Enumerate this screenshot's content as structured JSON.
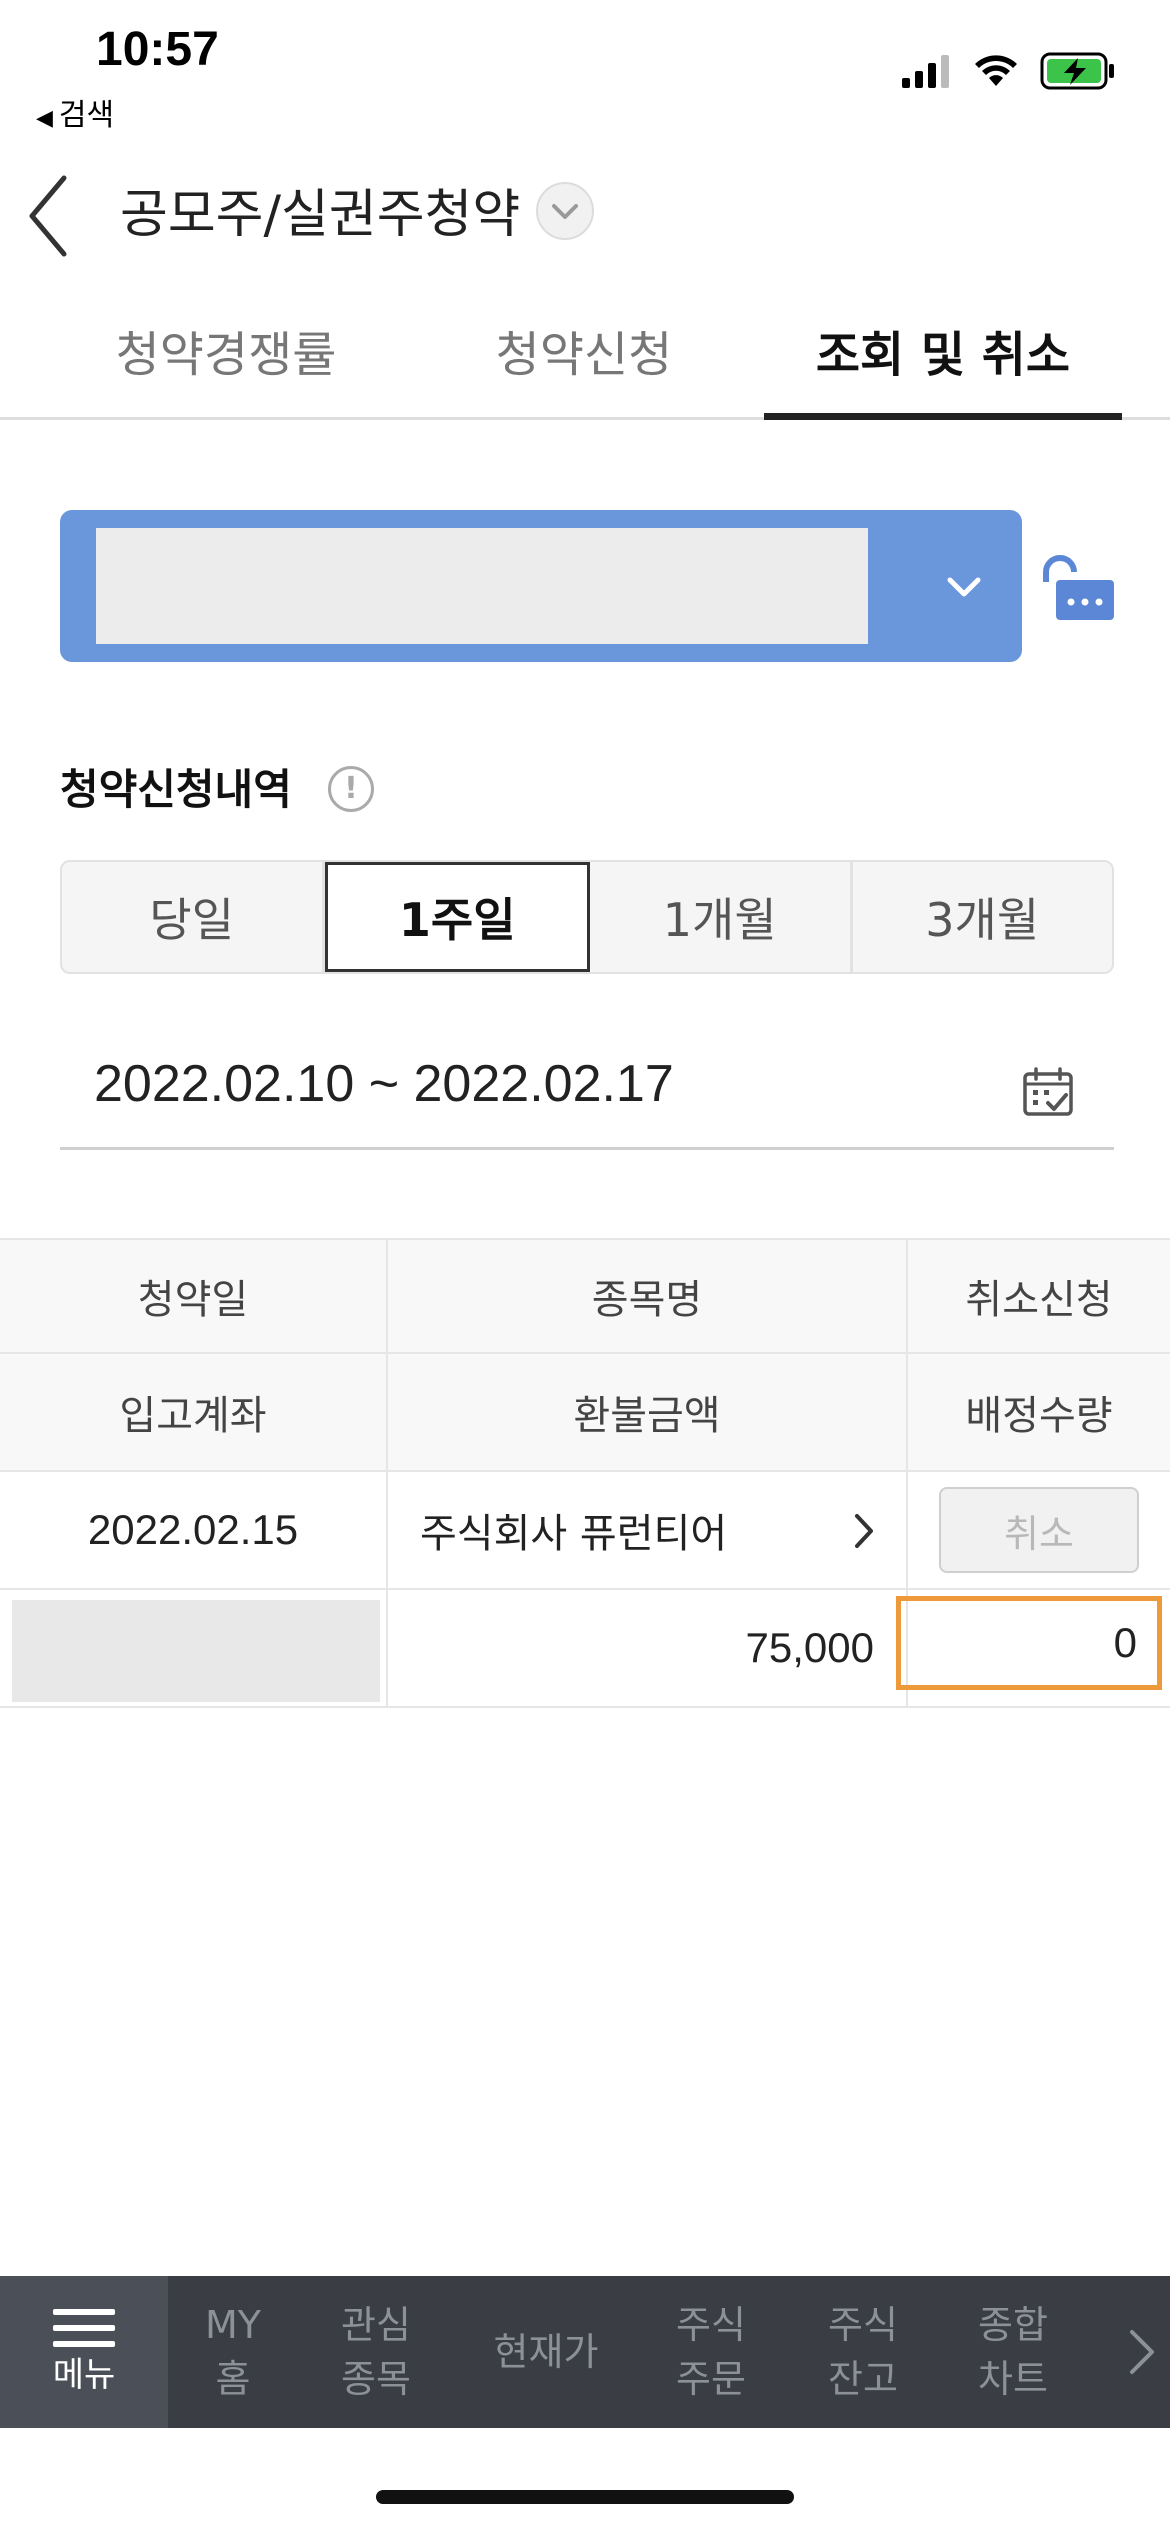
{
  "status": {
    "time": "10:57",
    "back_label": "검색"
  },
  "header": {
    "title": "공모주/실권주청약"
  },
  "tabs": [
    {
      "label": "청약경쟁률",
      "active": false
    },
    {
      "label": "청약신청",
      "active": false
    },
    {
      "label": "조회 및 취소",
      "active": true
    }
  ],
  "section": {
    "title": "청약신청내역",
    "info_symbol": "!"
  },
  "periods": [
    {
      "label": "당일",
      "active": false
    },
    {
      "label": "1주일",
      "active": true
    },
    {
      "label": "1개월",
      "active": false
    },
    {
      "label": "3개월",
      "active": false
    }
  ],
  "date_range": "2022.02.10 ~ 2022.02.17",
  "table": {
    "headers_row1": [
      "청약일",
      "종목명",
      "취소신청"
    ],
    "headers_row2": [
      "입고계좌",
      "환불금액",
      "배정수량"
    ],
    "rows": [
      {
        "date": "2022.02.15",
        "name": "주식회사 퓨런티어",
        "cancel_label": "취소",
        "refund": "75,000",
        "allotted": "0"
      }
    ]
  },
  "bottom_nav": {
    "menu": "메뉴",
    "items": [
      {
        "line1": "MY",
        "line2": "홈"
      },
      {
        "line1": "관심",
        "line2": "종목"
      },
      {
        "line1": "현재가",
        "line2": ""
      },
      {
        "line1": "주식",
        "line2": "주문"
      },
      {
        "line1": "주식",
        "line2": "잔고"
      },
      {
        "line1": "종합",
        "line2": "차트"
      }
    ]
  },
  "colors": {
    "accent_blue": "#6a96dc",
    "highlight_orange": "#ef9a3a",
    "nav_bg": "#3a3d44"
  }
}
